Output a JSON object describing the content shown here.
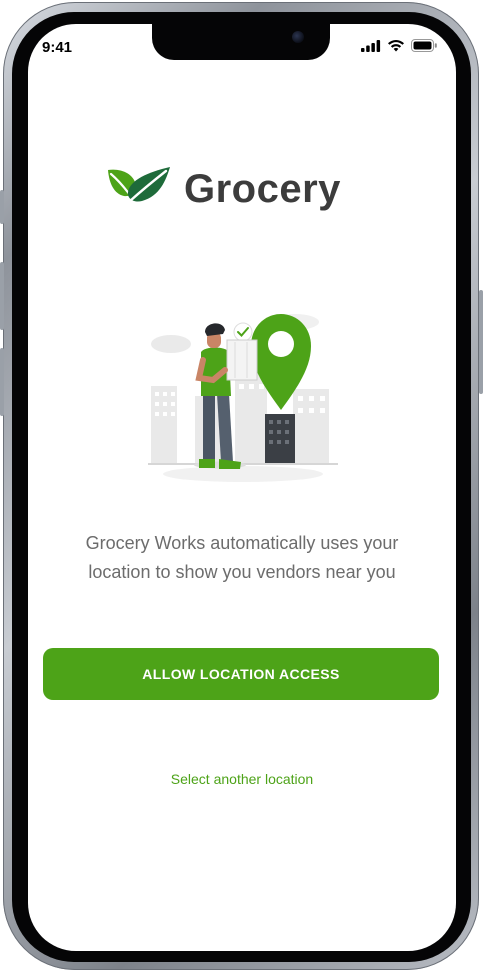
{
  "status_bar": {
    "time": "9:41",
    "icons": [
      "cellular-signal-icon",
      "wifi-icon",
      "battery-icon"
    ]
  },
  "brand": {
    "name": "Grocery",
    "logo_icon": "leaves-icon",
    "colors": {
      "primary": "#4da318",
      "text": "#3c3c3c"
    }
  },
  "illustration": {
    "icon": "location-pin-illustration"
  },
  "description": {
    "line1": "Grocery Works automatically uses your",
    "line2": "location to show you vendors near you"
  },
  "actions": {
    "allow_label": "ALLOW LOCATION ACCESS",
    "select_other_label": "Select another location"
  }
}
